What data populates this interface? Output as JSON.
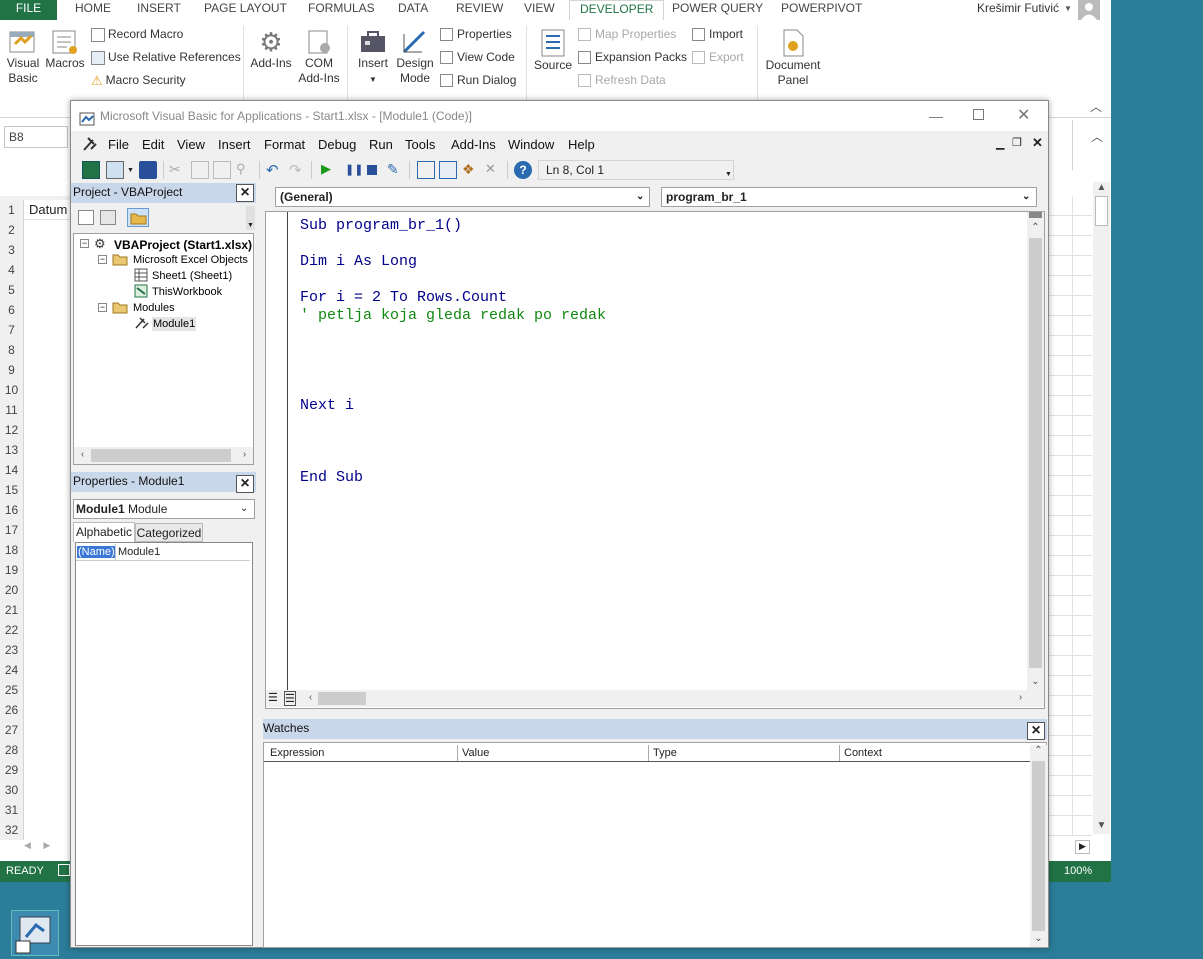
{
  "excel": {
    "tabs": [
      "FILE",
      "HOME",
      "INSERT",
      "PAGE LAYOUT",
      "FORMULAS",
      "DATA",
      "REVIEW",
      "VIEW",
      "DEVELOPER",
      "POWER QUERY",
      "POWERPIVOT"
    ],
    "active_tab": "DEVELOPER",
    "user": "Krešimir Futivić",
    "ribbon": {
      "visual_basic": [
        "Visual",
        "Basic"
      ],
      "macros": "Macros",
      "record_macro": "Record Macro",
      "relative_refs": "Use Relative References",
      "macro_security": "Macro Security",
      "addins": [
        "Add-Ins"
      ],
      "com_addins": [
        "COM",
        "Add-Ins"
      ],
      "insert": "Insert",
      "design_mode": [
        "Design",
        "Mode"
      ],
      "properties": "Properties",
      "view_code": "View Code",
      "run_dialog": "Run Dialog",
      "source": "Source",
      "map_properties": "Map Properties",
      "expansion_packs": "Expansion Packs",
      "refresh_data": "Refresh Data",
      "import": "Import",
      "export": "Export",
      "document_panel": [
        "Document",
        "Panel"
      ]
    },
    "name_box": "B8",
    "cell_a1": "Datum",
    "row_numbers": [
      "1",
      "2",
      "3",
      "4",
      "5",
      "6",
      "7",
      "8",
      "9",
      "10",
      "11",
      "12",
      "13",
      "14",
      "15",
      "16",
      "17",
      "18",
      "19",
      "20",
      "21",
      "22",
      "23",
      "24",
      "25",
      "26",
      "27",
      "28",
      "29",
      "30",
      "31",
      "32"
    ],
    "status": "READY",
    "zoom": "100%"
  },
  "vbe": {
    "title": "Microsoft Visual Basic for Applications - Start1.xlsx - [Module1 (Code)]",
    "menu": [
      "File",
      "Edit",
      "View",
      "Insert",
      "Format",
      "Debug",
      "Run",
      "Tools",
      "Add-Ins",
      "Window",
      "Help"
    ],
    "cursor_pos": "Ln 8, Col 1",
    "project": {
      "title": "Project - VBAProject",
      "root": "VBAProject (Start1.xlsx)",
      "excel_objects": "Microsoft Excel Objects",
      "sheet1": "Sheet1 (Sheet1)",
      "thisworkbook": "ThisWorkbook",
      "modules": "Modules",
      "module1": "Module1"
    },
    "properties": {
      "title": "Properties - Module1",
      "object_name": "Module1",
      "object_type": "Module",
      "tab_alpha": "Alphabetic",
      "tab_cat": "Categorized",
      "prop_name": "(Name)",
      "prop_value": "Module1"
    },
    "code": {
      "object_combo": "(General)",
      "proc_combo": "program_br_1",
      "line1": "Sub program_br_1()",
      "line2": "Dim i As Long",
      "line3": "For i = 2 To Rows.Count",
      "line4": "' petlja koja gleda redak po redak",
      "line5": "Next i",
      "line6": "End Sub"
    },
    "watches": {
      "title": "Watches",
      "columns": [
        "Expression",
        "Value",
        "Type",
        "Context"
      ]
    }
  },
  "colors": {
    "excel_green": "#217346",
    "comment_green": "#118811",
    "keyword_blue": "#00008b",
    "desktop": "#2b7d99"
  }
}
